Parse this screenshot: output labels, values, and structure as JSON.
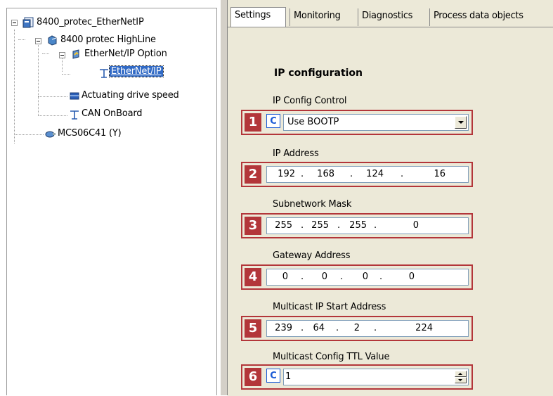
{
  "tree": {
    "root": {
      "label": "8400_protec_EtherNetIP",
      "icon": "project-icon"
    },
    "device": {
      "label": "8400 protec HighLine",
      "icon": "drive-icon"
    },
    "option": {
      "label": "EtherNet/IP Option",
      "icon": "module-icon"
    },
    "selected": {
      "label": "EtherNet/IP",
      "icon": "network-icon"
    },
    "speed": {
      "label": "Actuating drive speed",
      "icon": "function-icon"
    },
    "can": {
      "label": "CAN OnBoard",
      "icon": "network-icon"
    },
    "motor": {
      "label": "MCS06C41 (Y)",
      "icon": "motor-icon"
    }
  },
  "tabs": [
    "Settings",
    "Monitoring",
    "Diagnostics",
    "Process data objects"
  ],
  "section_title": "IP configuration",
  "fields": {
    "ip_config_control": {
      "label": "IP Config Control",
      "badge": "1",
      "c": "C",
      "value": "Use BOOTP"
    },
    "ip_address": {
      "label": "IP Address",
      "badge": "2",
      "octets": [
        "192",
        "168",
        "124",
        "16"
      ]
    },
    "subnet_mask": {
      "label": "Subnetwork Mask",
      "badge": "3",
      "octets": [
        "255",
        "255",
        "255",
        "0"
      ]
    },
    "gateway": {
      "label": "Gateway Address",
      "badge": "4",
      "octets": [
        "0",
        "0",
        "0",
        "0"
      ]
    },
    "multicast_start": {
      "label": "Multicast IP Start Address",
      "badge": "5",
      "octets": [
        "239",
        "64",
        "2",
        "224"
      ]
    },
    "multicast_ttl": {
      "label": "Multicast Config TTL Value",
      "badge": "6",
      "c": "C",
      "value": "1"
    }
  },
  "colors": {
    "badge": "#b3363a",
    "panel_bg": "#ece9d8",
    "selection": "#316ac5"
  }
}
